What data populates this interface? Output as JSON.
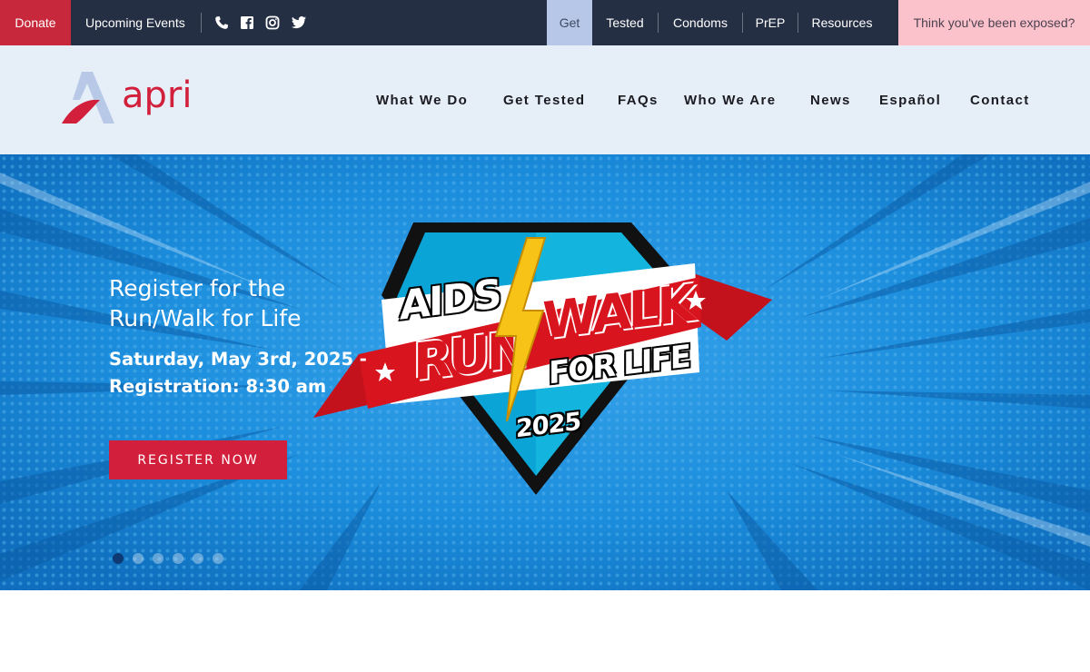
{
  "topbar": {
    "donate": "Donate",
    "events": "Upcoming Events",
    "social_icons": [
      "phone-icon",
      "facebook-icon",
      "instagram-icon",
      "twitter-icon"
    ],
    "links": [
      {
        "label": "Get",
        "highlighted": true
      },
      {
        "label": "Tested"
      },
      {
        "label": "Condoms"
      },
      {
        "label": "PrEP"
      },
      {
        "label": "Resources"
      }
    ],
    "exposed": "Think you've been exposed?"
  },
  "header": {
    "logo_text": "apri",
    "nav": [
      "What We Do",
      "Get Tested",
      "FAQs",
      "Who We Are",
      "News",
      "Español",
      "Contact"
    ]
  },
  "hero": {
    "title": "Register for the Run/Walk for Life",
    "date": "Saturday, May 3rd, 2025 - Registration: 8:30 am",
    "button": "REGISTER NOW",
    "badge": {
      "line1": "AIDS",
      "line2a": "RUN",
      "line2b": "WALK",
      "line3": "FOR LIFE",
      "year": "2025"
    },
    "slides": 6,
    "active_slide": 0
  },
  "colors": {
    "topbar_bg": "#252f44",
    "donate_bg": "#c8283b",
    "header_bg": "#e6eef8",
    "brand_red": "#d21f3c",
    "hero_blue": "#1787d8",
    "exposed_bg": "#fbc2cb"
  }
}
